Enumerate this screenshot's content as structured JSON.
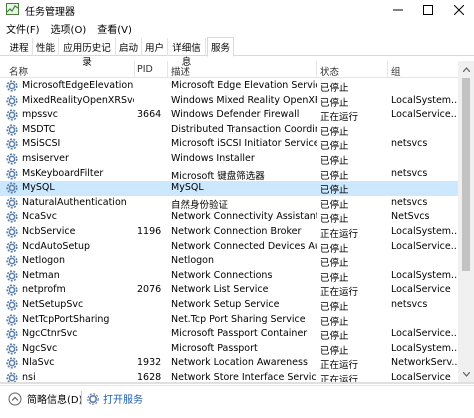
{
  "window": {
    "title": "任务管理器"
  },
  "menu": [
    "文件(F)",
    "选项(O)",
    "查看(V)"
  ],
  "tabs": [
    "进程",
    "性能",
    "应用历史记录",
    "启动",
    "用户",
    "详细信息",
    "服务"
  ],
  "active_tab": "服务",
  "columns": {
    "name": "名称",
    "pid": "PID",
    "desc": "描述",
    "status": "状态",
    "group": "组"
  },
  "services": [
    {
      "name": "MicrosoftEdgeElevationS...",
      "pid": "",
      "desc": "Microsoft Edge Elevation Service...",
      "status": "已停止",
      "group": ""
    },
    {
      "name": "MixedRealityOpenXRSvc",
      "pid": "",
      "desc": "Windows Mixed Reality OpenXR ...",
      "status": "已停止",
      "group": "LocalSystem..."
    },
    {
      "name": "mpssvc",
      "pid": "3664",
      "desc": "Windows Defender Firewall",
      "status": "正在运行",
      "group": "LocalService..."
    },
    {
      "name": "MSDTC",
      "pid": "",
      "desc": "Distributed Transaction Coordina...",
      "status": "已停止",
      "group": ""
    },
    {
      "name": "MSiSCSI",
      "pid": "",
      "desc": "Microsoft iSCSI Initiator Service",
      "status": "已停止",
      "group": "netsvcs"
    },
    {
      "name": "msiserver",
      "pid": "",
      "desc": "Windows Installer",
      "status": "已停止",
      "group": ""
    },
    {
      "name": "MsKeyboardFilter",
      "pid": "",
      "desc": "Microsoft 键盘筛选器",
      "status": "已停止",
      "group": "netsvcs"
    },
    {
      "name": "MySQL",
      "pid": "",
      "desc": "MySQL",
      "status": "已停止",
      "group": "",
      "selected": true
    },
    {
      "name": "NaturalAuthentication",
      "pid": "",
      "desc": "自然身份验证",
      "status": "已停止",
      "group": "netsvcs"
    },
    {
      "name": "NcaSvc",
      "pid": "",
      "desc": "Network Connectivity Assistant",
      "status": "已停止",
      "group": "NetSvcs"
    },
    {
      "name": "NcbService",
      "pid": "1196",
      "desc": "Network Connection Broker",
      "status": "正在运行",
      "group": "LocalSystem..."
    },
    {
      "name": "NcdAutoSetup",
      "pid": "",
      "desc": "Network Connected Devices Auto...",
      "status": "已停止",
      "group": "LocalService..."
    },
    {
      "name": "Netlogon",
      "pid": "",
      "desc": "Netlogon",
      "status": "已停止",
      "group": ""
    },
    {
      "name": "Netman",
      "pid": "",
      "desc": "Network Connections",
      "status": "已停止",
      "group": "LocalSystem..."
    },
    {
      "name": "netprofm",
      "pid": "2076",
      "desc": "Network List Service",
      "status": "正在运行",
      "group": "LocalService"
    },
    {
      "name": "NetSetupSvc",
      "pid": "",
      "desc": "Network Setup Service",
      "status": "已停止",
      "group": "netsvcs"
    },
    {
      "name": "NetTcpPortSharing",
      "pid": "",
      "desc": "Net.Tcp Port Sharing Service",
      "status": "已停止",
      "group": ""
    },
    {
      "name": "NgcCtnrSvc",
      "pid": "",
      "desc": "Microsoft Passport Container",
      "status": "已停止",
      "group": "LocalService..."
    },
    {
      "name": "NgcSvc",
      "pid": "",
      "desc": "Microsoft Passport",
      "status": "已停止",
      "group": "LocalSystem..."
    },
    {
      "name": "NlaSvc",
      "pid": "1932",
      "desc": "Network Location Awareness",
      "status": "正在运行",
      "group": "NetworkServ..."
    },
    {
      "name": "nsi",
      "pid": "1628",
      "desc": "Network Store Interface Service",
      "status": "正在运行",
      "group": "LocalService"
    }
  ],
  "footer": {
    "summary": "简略信息(D)",
    "open_services": "打开服务"
  },
  "colors": {
    "selected_row": "#cce8ff",
    "link": "#1a5fb4",
    "gear": "#5b7ea8"
  }
}
